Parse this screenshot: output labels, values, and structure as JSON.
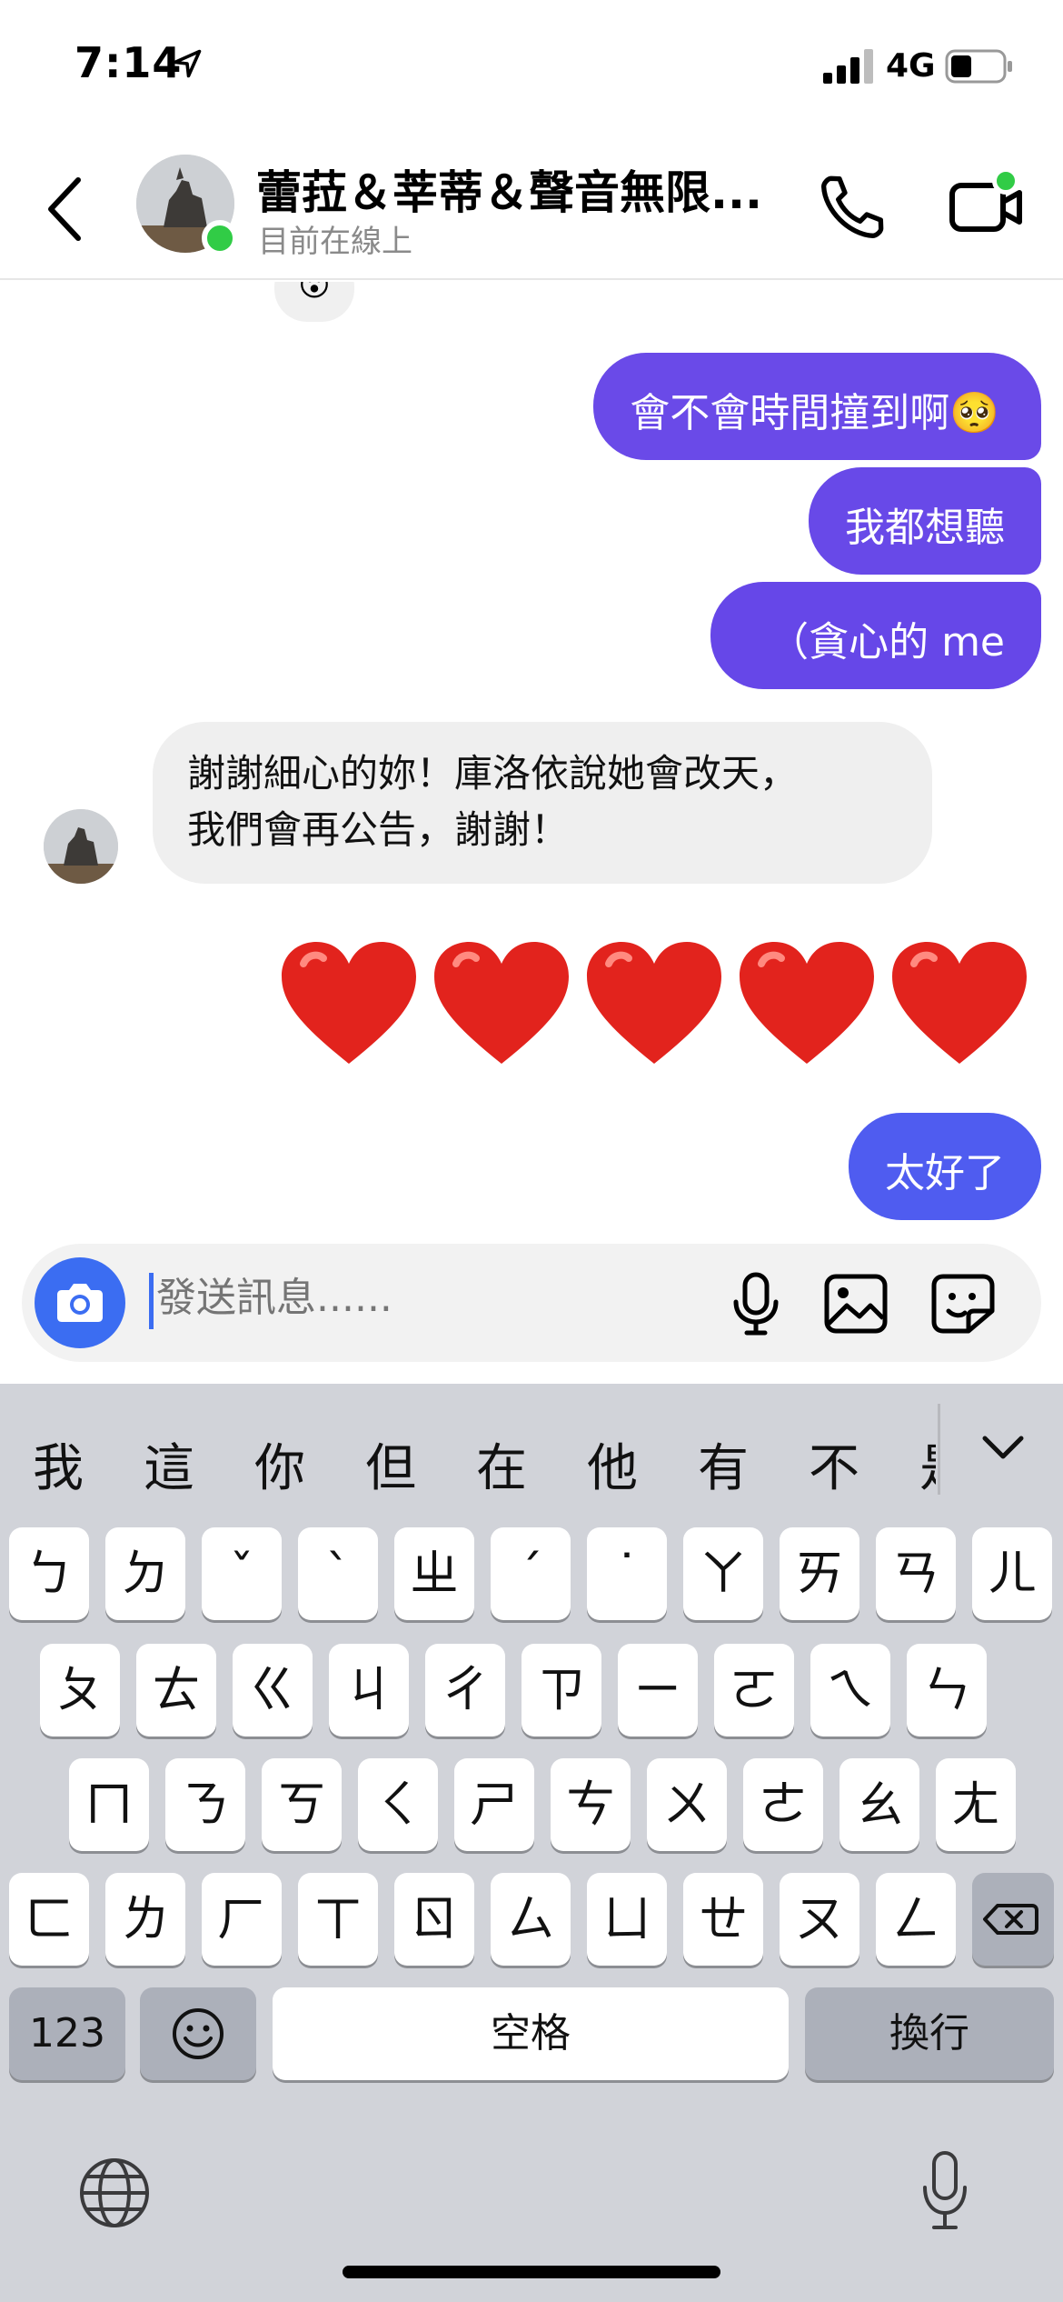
{
  "status_bar": {
    "time": "7:14",
    "network": "4G",
    "location_icon": "location-arrow-icon",
    "battery_level": 0.4
  },
  "header": {
    "title": "蕾菈＆莘蒂＆聲音無限...",
    "subtitle": "目前在線上",
    "presence_color": "#31cc46"
  },
  "messages": {
    "sent_1": "會不會時間撞到啊🥺",
    "sent_2": "我都想聽",
    "sent_3": "（貪心的 me",
    "received_line_1": "謝謝細心的妳！庫洛依說她會改天，",
    "received_line_2": "我們會再公告，謝謝！",
    "hearts": [
      "❤️",
      "❤️",
      "❤️",
      "❤️",
      "❤️"
    ],
    "sent_4": "太好了"
  },
  "composer": {
    "placeholder": "發送訊息......"
  },
  "keyboard": {
    "suggestions": [
      "我",
      "這",
      "你",
      "但",
      "在",
      "他",
      "有",
      "不",
      "是"
    ],
    "row1": [
      "ㄅ",
      "ㄉ",
      "ˇ",
      "ˋ",
      "ㄓ",
      "ˊ",
      "˙",
      "ㄚ",
      "ㄞ",
      "ㄢ",
      "ㄦ"
    ],
    "row2": [
      "ㄆ",
      "ㄊ",
      "ㄍ",
      "ㄐ",
      "ㄔ",
      "ㄗ",
      "ㄧ",
      "ㄛ",
      "ㄟ",
      "ㄣ"
    ],
    "row3": [
      "ㄇ",
      "ㄋ",
      "ㄎ",
      "ㄑ",
      "ㄕ",
      "ㄘ",
      "ㄨ",
      "ㄜ",
      "ㄠ",
      "ㄤ"
    ],
    "row4": [
      "ㄈ",
      "ㄌ",
      "ㄏ",
      "ㄒ",
      "ㄖ",
      "ㄙ",
      "ㄩ",
      "ㄝ",
      "ㄡ",
      "ㄥ"
    ],
    "numbers_key": "123",
    "space_key": "空格",
    "return_key": "換行",
    "colors": {
      "key": "#ffffff",
      "function_key": "#acb0ba",
      "background": "#d1d3d9"
    }
  },
  "colors": {
    "sent_bubble": "#6a4ae8",
    "sent_bubble_last": "#4f5cf0",
    "received_bubble": "#efefef",
    "accent": "#3b6df2"
  }
}
